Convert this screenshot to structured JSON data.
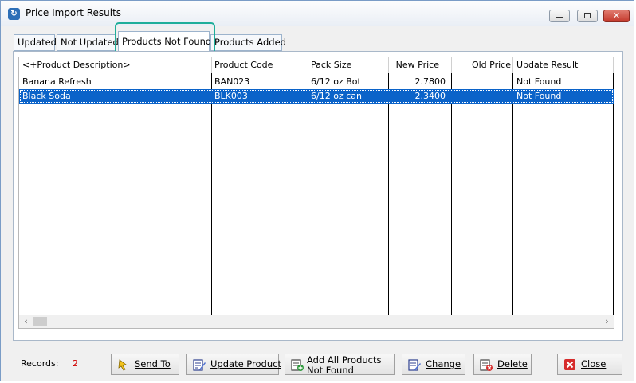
{
  "window": {
    "title": "Price Import Results"
  },
  "tabs": [
    {
      "label": "Updated"
    },
    {
      "label": "Not Updated"
    },
    {
      "label": "Products Not Found"
    },
    {
      "label": "Products Added"
    }
  ],
  "grid": {
    "columns": [
      "<+Product Description>",
      "Product Code",
      "Pack Size",
      "New Price",
      "Old Price",
      "Update Result"
    ],
    "rows": [
      {
        "description": "Banana Refresh",
        "code": "BAN023",
        "pack": "6/12 oz Bot",
        "new_price": "2.7800",
        "old_price": "",
        "result": "Not Found",
        "selected": false
      },
      {
        "description": "Black Soda",
        "code": "BLK003",
        "pack": "6/12 oz can",
        "new_price": "2.3400",
        "old_price": "",
        "result": "Not Found",
        "selected": true
      }
    ]
  },
  "status": {
    "records_label": "Records:",
    "records_value": "2"
  },
  "buttons": {
    "send_to": "Send To",
    "update_product": "Update Product",
    "add_all_line1": "Add All Products",
    "add_all_line2": "Not Found",
    "change": "Change",
    "delete": "Delete",
    "close": "Close"
  },
  "colors": {
    "selection": "#0b63c9",
    "highlight_ring": "#1fae9a",
    "records_value": "#d00000"
  }
}
